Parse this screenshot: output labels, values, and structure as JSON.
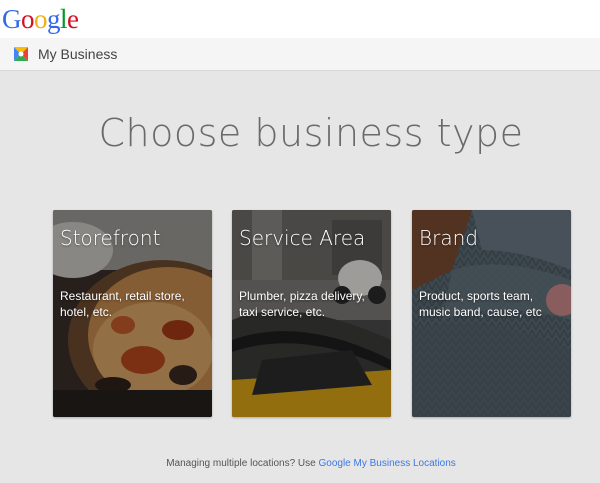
{
  "header": {
    "logo_letters": [
      {
        "char": "G",
        "color": "#3369e8"
      },
      {
        "char": "o",
        "color": "#d50f25"
      },
      {
        "char": "o",
        "color": "#eeb211"
      },
      {
        "char": "g",
        "color": "#3369e8"
      },
      {
        "char": "l",
        "color": "#009925"
      },
      {
        "char": "e",
        "color": "#d50f25"
      }
    ],
    "product_name": "My Business",
    "product_icon": "google-my-business-icon"
  },
  "main": {
    "heading": "Choose business type",
    "cards": [
      {
        "title": "Storefront",
        "description": "Restaurant, retail store, hotel, etc.",
        "image": "pizza"
      },
      {
        "title": "Service Area",
        "description": "Plumber, pizza delivery, taxi service, etc.",
        "image": "taxi-street"
      },
      {
        "title": "Brand",
        "description": "Product, sports team, music band, cause, etc",
        "image": "knit-sweater"
      }
    ]
  },
  "footer": {
    "text": "Managing multiple locations? Use ",
    "link": "Google My Business Locations"
  },
  "colors": {
    "background": "#e6e6e6",
    "link": "#3b78e7",
    "heading": "#6a6a6a"
  }
}
